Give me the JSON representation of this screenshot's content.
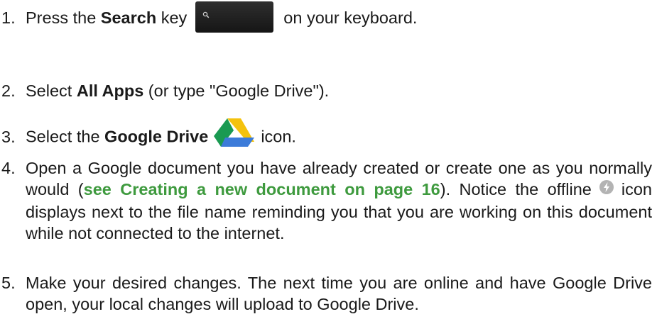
{
  "steps": [
    {
      "num": "1.",
      "before": "Press the ",
      "bold": "Search",
      "after1": " key",
      "after2": "on your keyboard.",
      "key_icon": "search-key-icon"
    },
    {
      "num": "2.",
      "before": "Select ",
      "bold": "All Apps",
      "after": " (or type \"Google Drive\")."
    },
    {
      "num": "3.",
      "before": "Select the ",
      "bold": "Google Drive",
      "after": "icon.",
      "icon": "google-drive-icon"
    },
    {
      "num": "4.",
      "before": "Open a Google document you have already created or create one as you normally would (",
      "link": "see Creating a new document on page 16",
      "middle": "). Notice the offline",
      "after": "icon displays next to the file name reminding you that you are working on this document while not connected to the internet.",
      "icon": "offline-icon"
    },
    {
      "num": "5.",
      "text": "Make your desired changes. The next time you are online and have Google Drive open, your local changes will upload to Google Drive."
    }
  ],
  "colors": {
    "link": "#3e9a3e",
    "key": "#1f1f1f"
  }
}
